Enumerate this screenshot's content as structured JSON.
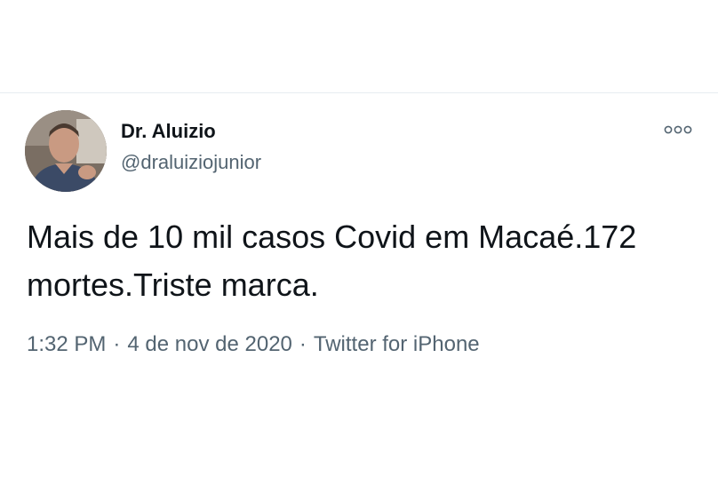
{
  "tweet": {
    "author": {
      "display_name": "Dr. Aluizio",
      "handle": "@draluiziojunior"
    },
    "text": "Mais de 10 mil casos Covid em Macaé.172 mortes.Triste marca.",
    "time": "1:32 PM",
    "date": "4 de nov de 2020",
    "source": "Twitter for iPhone",
    "separator": "·",
    "more_icon": "more-options-icon"
  },
  "colors": {
    "text_primary": "#0f1419",
    "text_secondary": "#536471",
    "divider": "#e6ecf0"
  }
}
